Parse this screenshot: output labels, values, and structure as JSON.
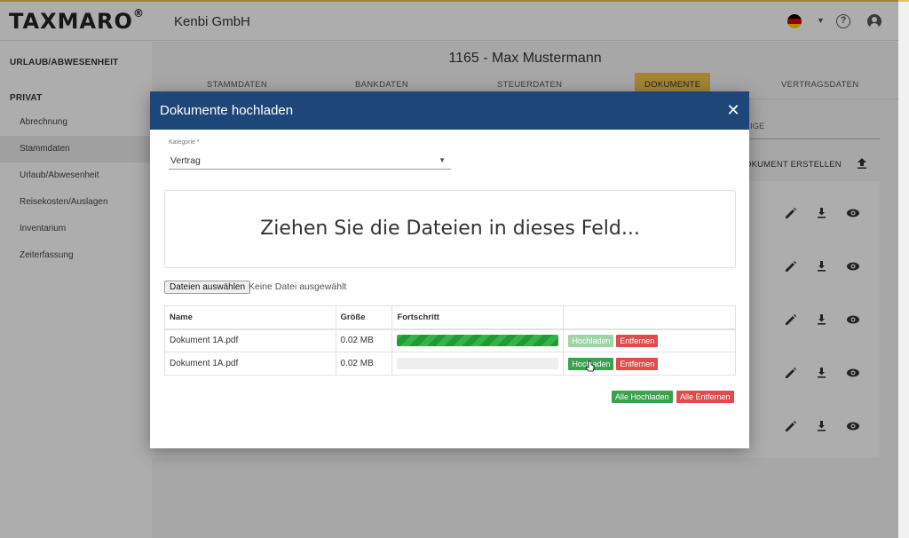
{
  "app": {
    "brand": "TAXMARO",
    "brand_mark": "®",
    "company": "Kenbi GmbH"
  },
  "header": {
    "flag_colors": [
      "#000000",
      "#dd0000",
      "#ffce00"
    ],
    "help_glyph": "?",
    "icons": [
      "germany-flag-icon",
      "chevron-down-icon",
      "help-icon",
      "user-account-icon"
    ]
  },
  "sidebar": {
    "section1": "URLAUB/ABWESENHEIT",
    "section2": "PRIVAT",
    "items": [
      {
        "label": "Abrechnung"
      },
      {
        "label": "Stammdaten"
      },
      {
        "label": "Urlaub/Abwesenheit"
      },
      {
        "label": "Reisekosten/Auslagen"
      },
      {
        "label": "Inventarium"
      },
      {
        "label": "Zeiterfassung"
      }
    ],
    "active_item": "Stammdaten"
  },
  "main": {
    "title": "1165 - Max Mustermann",
    "tabs": [
      {
        "label": "STAMMDATEN"
      },
      {
        "label": "BANKDATEN"
      },
      {
        "label": "STEUERDATEN"
      },
      {
        "label": "DOKUMENTE"
      },
      {
        "label": "VERTRAGSDATEN"
      }
    ],
    "active_tab": "DOKUMENTE",
    "subtab_fragment": "IGE",
    "create_doc_fragment": "OKUMENT ERSTELLEN",
    "row_icons": [
      "edit-icon",
      "download-icon",
      "view-icon"
    ],
    "row_count": 5
  },
  "modal": {
    "title": "Dokumente hochladen",
    "close_glyph": "✕",
    "category_label": "Kategorie *",
    "category_value": "Vertrag",
    "dropzone_text": "Ziehen Sie die Dateien in dieses Feld...",
    "choose_files": "Dateien auswählen",
    "no_file": "Keine Datei ausgewählt",
    "table": {
      "headers": [
        "Name",
        "Größe",
        "Fortschritt",
        ""
      ],
      "rows": [
        {
          "name": "Dokument 1A.pdf",
          "size": "0.02 MB",
          "progress": 1.0,
          "upload": "Hochladen",
          "remove": "Entfernen",
          "uploaded": true
        },
        {
          "name": "Dokument 1A.pdf",
          "size": "0.02 MB",
          "progress": 0.0,
          "upload": "Hochladen",
          "remove": "Entfernen",
          "uploaded": false
        }
      ]
    },
    "upload_all": "Alle Hochladen",
    "remove_all": "Alle Entfernen"
  },
  "colors": {
    "accent_yellow": "#f1c54a",
    "modal_header": "#1e4679",
    "green": "#3aa14f",
    "red": "#e04b4b"
  }
}
